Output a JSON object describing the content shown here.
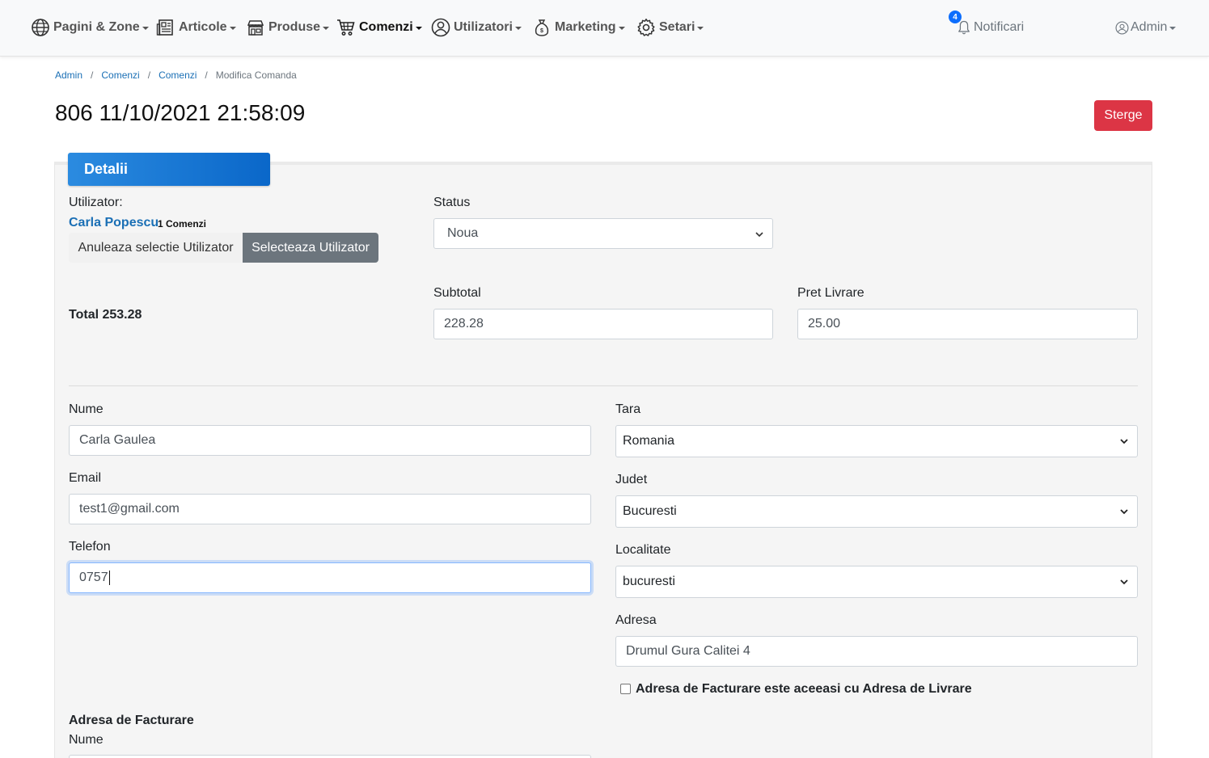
{
  "nav": {
    "items": [
      {
        "label": "Pagini & Zone",
        "icon": "globe-icon"
      },
      {
        "label": "Articole",
        "icon": "newspaper-icon"
      },
      {
        "label": "Produse",
        "icon": "shop-icon"
      },
      {
        "label": "Comenzi",
        "icon": "cart-icon",
        "active": true
      },
      {
        "label": "Utilizatori",
        "icon": "user-circle-icon"
      },
      {
        "label": "Marketing",
        "icon": "money-bag-icon"
      },
      {
        "label": "Setari",
        "icon": "gear-icon"
      }
    ],
    "notifications": {
      "label": "Notificari",
      "count": "4"
    },
    "account": {
      "label": "Admin"
    }
  },
  "breadcrumb": [
    "Admin",
    "Comenzi",
    "Comenzi",
    "Modifica Comanda"
  ],
  "page": {
    "title": "806 11/10/2021 21:58:09",
    "delete_label": "Sterge",
    "tab_label": "Detalii"
  },
  "user": {
    "label": "Utilizator:",
    "name": "Carla Popescu",
    "orders": "1 Comenzi",
    "clear_label": "Anuleaza selectie Utilizator",
    "select_label": "Selecteaza Utilizator"
  },
  "status": {
    "label": "Status",
    "value": "Noua"
  },
  "totals": {
    "total_text": "Total 253.28",
    "subtotal_label": "Subtotal",
    "subtotal_value": "228.28",
    "shipping_label": "Pret Livrare",
    "shipping_value": "25.00"
  },
  "delivery": {
    "name_label": "Nume",
    "name_value": "Carla Gaulea",
    "email_label": "Email",
    "email_value": "test1@gmail.com",
    "phone_label": "Telefon",
    "phone_value": "0757",
    "country_label": "Tara",
    "country_value": "Romania",
    "county_label": "Judet",
    "county_value": "Bucuresti",
    "city_label": "Localitate",
    "city_value": "bucuresti",
    "address_label": "Adresa",
    "address_value": "Drumul Gura Calitei 4",
    "same_billing_label": "Adresa de Facturare este aceeasi cu Adresa de Livrare"
  },
  "billing": {
    "heading": "Adresa de Facturare",
    "name_label": "Nume"
  },
  "colors": {
    "accent": "#0a67c9",
    "danger": "#dc3545",
    "secondary": "#6c757d",
    "link": "#1a6fb5"
  }
}
